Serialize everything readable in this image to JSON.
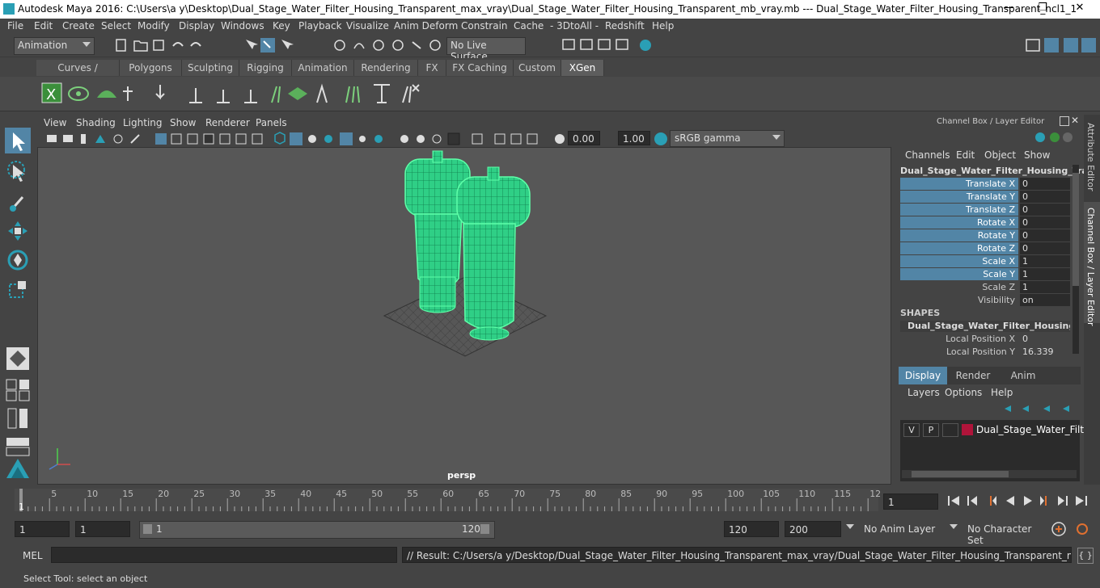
{
  "window": {
    "title": "Autodesk Maya 2016: C:\\Users\\a y\\Desktop\\Dual_Stage_Water_Filter_Housing_Transparent_max_vray\\Dual_Stage_Water_Filter_Housing_Transparent_mb_vray.mb   ---   Dual_Stage_Water_Filter_Housing_Transparent_ncl1_1",
    "minimize": "—",
    "maximize": "❐",
    "close": "✕"
  },
  "menubar": [
    "File",
    "Edit",
    "Create",
    "Select",
    "Modify",
    "Display",
    "Windows",
    "Key",
    "Playback",
    "Visualize",
    "Anim Deform",
    "Constrain",
    "Cache",
    "- 3DtoAll -",
    "Redshift",
    "Help"
  ],
  "status_line": {
    "mode": "Animation",
    "live_surface": "No Live Surface"
  },
  "shelf_tabs": [
    "Curves / Surfaces",
    "Polygons",
    "Sculpting",
    "Rigging",
    "Animation",
    "Rendering",
    "FX",
    "FX Caching",
    "Custom",
    "XGen"
  ],
  "active_shelf_tab": "XGen",
  "viewport": {
    "menus": [
      "View",
      "Shading",
      "Lighting",
      "Show",
      "Renderer",
      "Panels"
    ],
    "exposure": "0.00",
    "gamma": "1.00",
    "color_space": "sRGB gamma",
    "camera_label": "persp"
  },
  "channel_box": {
    "header": "Channel Box / Layer Editor",
    "menus": [
      "Channels",
      "Edit",
      "Object",
      "Show"
    ],
    "object_name": "Dual_Stage_Water_Filter_Housing_Tra...",
    "channels": [
      {
        "label": "Translate X",
        "value": "0",
        "highlight": true
      },
      {
        "label": "Translate Y",
        "value": "0",
        "highlight": true
      },
      {
        "label": "Translate Z",
        "value": "0",
        "highlight": true
      },
      {
        "label": "Rotate X",
        "value": "0",
        "highlight": true
      },
      {
        "label": "Rotate Y",
        "value": "0",
        "highlight": true
      },
      {
        "label": "Rotate Z",
        "value": "0",
        "highlight": true
      },
      {
        "label": "Scale X",
        "value": "1",
        "highlight": true
      },
      {
        "label": "Scale Y",
        "value": "1",
        "highlight": true
      },
      {
        "label": "Scale Z",
        "value": "1",
        "highlight": false
      },
      {
        "label": "Visibility",
        "value": "on",
        "highlight": false
      }
    ],
    "shapes_header": "SHAPES",
    "shape_name": "Dual_Stage_Water_Filter_Housing_Tr...",
    "shape_channels": [
      {
        "label": "Local Position X",
        "value": "0"
      },
      {
        "label": "Local Position Y",
        "value": "16.339"
      }
    ]
  },
  "layer_editor": {
    "tabs": [
      "Display",
      "Render",
      "Anim"
    ],
    "active_tab": "Display",
    "menus": [
      "Layers",
      "Options",
      "Help"
    ],
    "layer": {
      "v": "V",
      "p": "P",
      "name": "Dual_Stage_Water_Filter",
      "color": "#b0143a"
    }
  },
  "side_tabs": {
    "attribute_editor": "Attribute Editor",
    "channel_box_layer_editor": "Channel Box / Layer Editor"
  },
  "timeline": {
    "ticks": [
      "5",
      "10",
      "15",
      "20",
      "25",
      "30",
      "35",
      "40",
      "45",
      "50",
      "55",
      "60",
      "65",
      "70",
      "75",
      "80",
      "85",
      "90",
      "95",
      "100",
      "105",
      "110",
      "115",
      "12"
    ],
    "first_frame_marker": "1",
    "current_frame": "1"
  },
  "range": {
    "start": "1",
    "playback_start": "1",
    "slider_start": "1",
    "slider_end": "120",
    "playback_end": "120",
    "end": "200",
    "anim_layer": "No Anim Layer",
    "character_set": "No Character Set"
  },
  "command_line": {
    "label": "MEL",
    "result": "// Result: C:/Users/a y/Desktop/Dual_Stage_Water_Filter_Housing_Transparent_max_vray/Dual_Stage_Water_Filter_Housing_Transparent_mb_vray.mb"
  },
  "help_line": "Select Tool: select an object",
  "colors": {
    "wireframe": "#5effa8",
    "highlight_channel": "#5285a6",
    "layer_color": "#b0143a",
    "accent_tab": "#5d5d5d"
  }
}
